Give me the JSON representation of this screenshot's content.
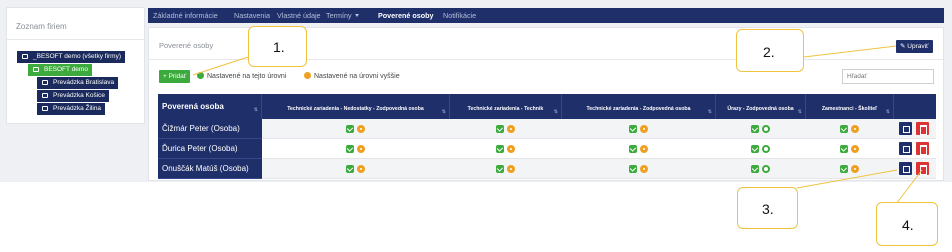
{
  "sidebar": {
    "title": "Zoznam firiem",
    "tree": [
      {
        "label": "_BESOFT demo (všetky firmy)"
      },
      {
        "label": "BESOFT demo"
      },
      {
        "label": "Prevádzka Bratislava"
      },
      {
        "label": "Prevádzka Košice"
      },
      {
        "label": "Prevádzka Žilina"
      }
    ]
  },
  "nav": {
    "items": [
      {
        "label": "Základné informácie"
      },
      {
        "label": "Nastavenia"
      },
      {
        "label": "Vlastné údaje"
      },
      {
        "label": "Termíny"
      },
      {
        "label": "Poverené osoby"
      },
      {
        "label": "Notifikácie"
      }
    ]
  },
  "panel": {
    "title": "Poverené osoby",
    "edit_button": "Upraviť",
    "add_button": "+ Pridať",
    "legend_this_level": "Nastavené na tejto úrovni",
    "legend_higher_level": "Nastavené na úrovni vyššie",
    "search_placeholder": "Hľadať"
  },
  "table": {
    "headers": [
      "Poverená osoba",
      "Technické zariadenia - Nedostatky - Zodpovedná osoba",
      "Technické zariadenia - Technik",
      "Technické zariadenia - Zodpovedná osoba",
      "Úrazy - Zodpovedná osoba",
      "Zamestnanci - Školiteľ"
    ],
    "rows": [
      {
        "name": "Čižmár Peter (Osoba)",
        "settings": [
          "orange",
          "orange",
          "orange",
          "green",
          "orange"
        ]
      },
      {
        "name": "Ďurica Peter (Osoba)",
        "settings": [
          "orange",
          "orange",
          "orange",
          "green",
          "orange"
        ]
      },
      {
        "name": "Onuščák Matúš (Osoba)",
        "settings": [
          "orange",
          "orange",
          "orange",
          "green",
          "orange"
        ]
      }
    ]
  },
  "callouts": [
    {
      "label": "1."
    },
    {
      "label": "2."
    },
    {
      "label": "3."
    },
    {
      "label": "4."
    }
  ],
  "colors": {
    "navy": "#1e2f6a",
    "green": "#3daa3d",
    "orange": "#f0a020",
    "red": "#dd3333",
    "callout_border": "#f0c340"
  }
}
